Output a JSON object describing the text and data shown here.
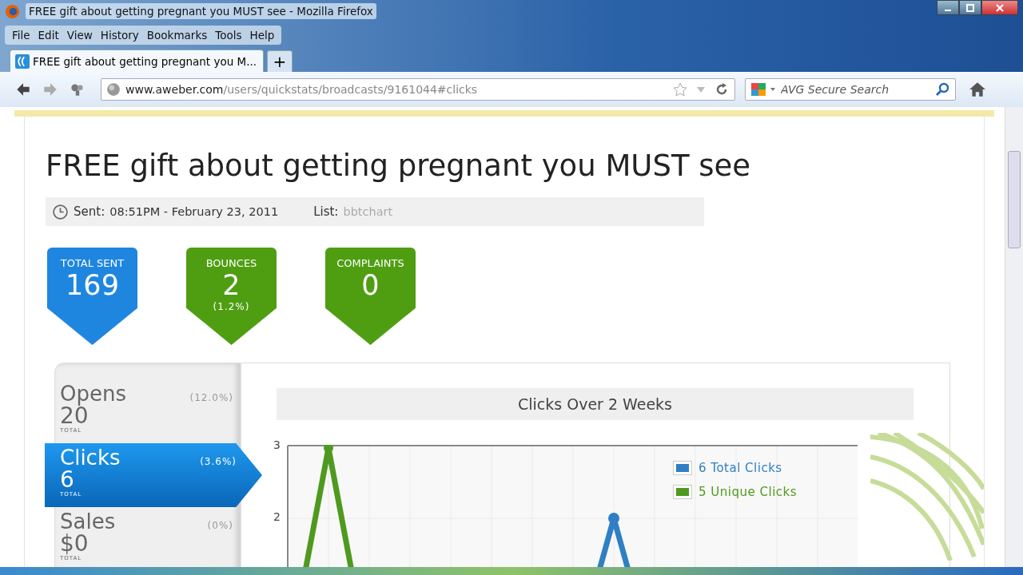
{
  "window": {
    "title": "FREE gift about getting pregnant you MUST see - Mozilla Firefox"
  },
  "menu": [
    "File",
    "Edit",
    "View",
    "History",
    "Bookmarks",
    "Tools",
    "Help"
  ],
  "tabs": [
    {
      "label": "FREE gift about getting pregnant you M...",
      "selected": true
    }
  ],
  "new_tab": "+",
  "address_bar": {
    "host": "www.aweber.com",
    "path": "/users/quickstats/broadcasts/9161044#clicks"
  },
  "search": {
    "placeholder": "AVG Secure Search"
  },
  "page": {
    "heading": "FREE gift about getting pregnant you MUST see",
    "sent_label": "Sent:",
    "sent_value": "08:51PM - February 23, 2011",
    "list_label": "List:",
    "list_value": "bbtchart",
    "stats": [
      {
        "label": "TOTAL SENT",
        "value": "169",
        "color": "#1f86e0"
      },
      {
        "label": "BOUNCES",
        "value": "2",
        "sub": "(1.2%)",
        "color": "#4f9e12"
      },
      {
        "label": "COMPLAINTS",
        "value": "0",
        "color": "#4f9e12"
      }
    ],
    "metrics": [
      {
        "name": "Opens",
        "percent": "(12.0%)",
        "value": "20",
        "unit": "TOTAL",
        "selected": false
      },
      {
        "name": "Clicks",
        "percent": "(3.6%)",
        "value": "6",
        "unit": "TOTAL",
        "selected": true
      },
      {
        "name": "Sales",
        "percent": "(0%)",
        "value": "$0",
        "unit": "TOTAL",
        "selected": false
      }
    ],
    "chart": {
      "title": "Clicks Over 2 Weeks",
      "y_ticks": [
        "3",
        "2"
      ],
      "legend": [
        {
          "label": "6 Total Clicks",
          "color": "#2f7fc4"
        },
        {
          "label": "5 Unique Clicks",
          "color": "#4e9a1e"
        }
      ]
    }
  }
}
